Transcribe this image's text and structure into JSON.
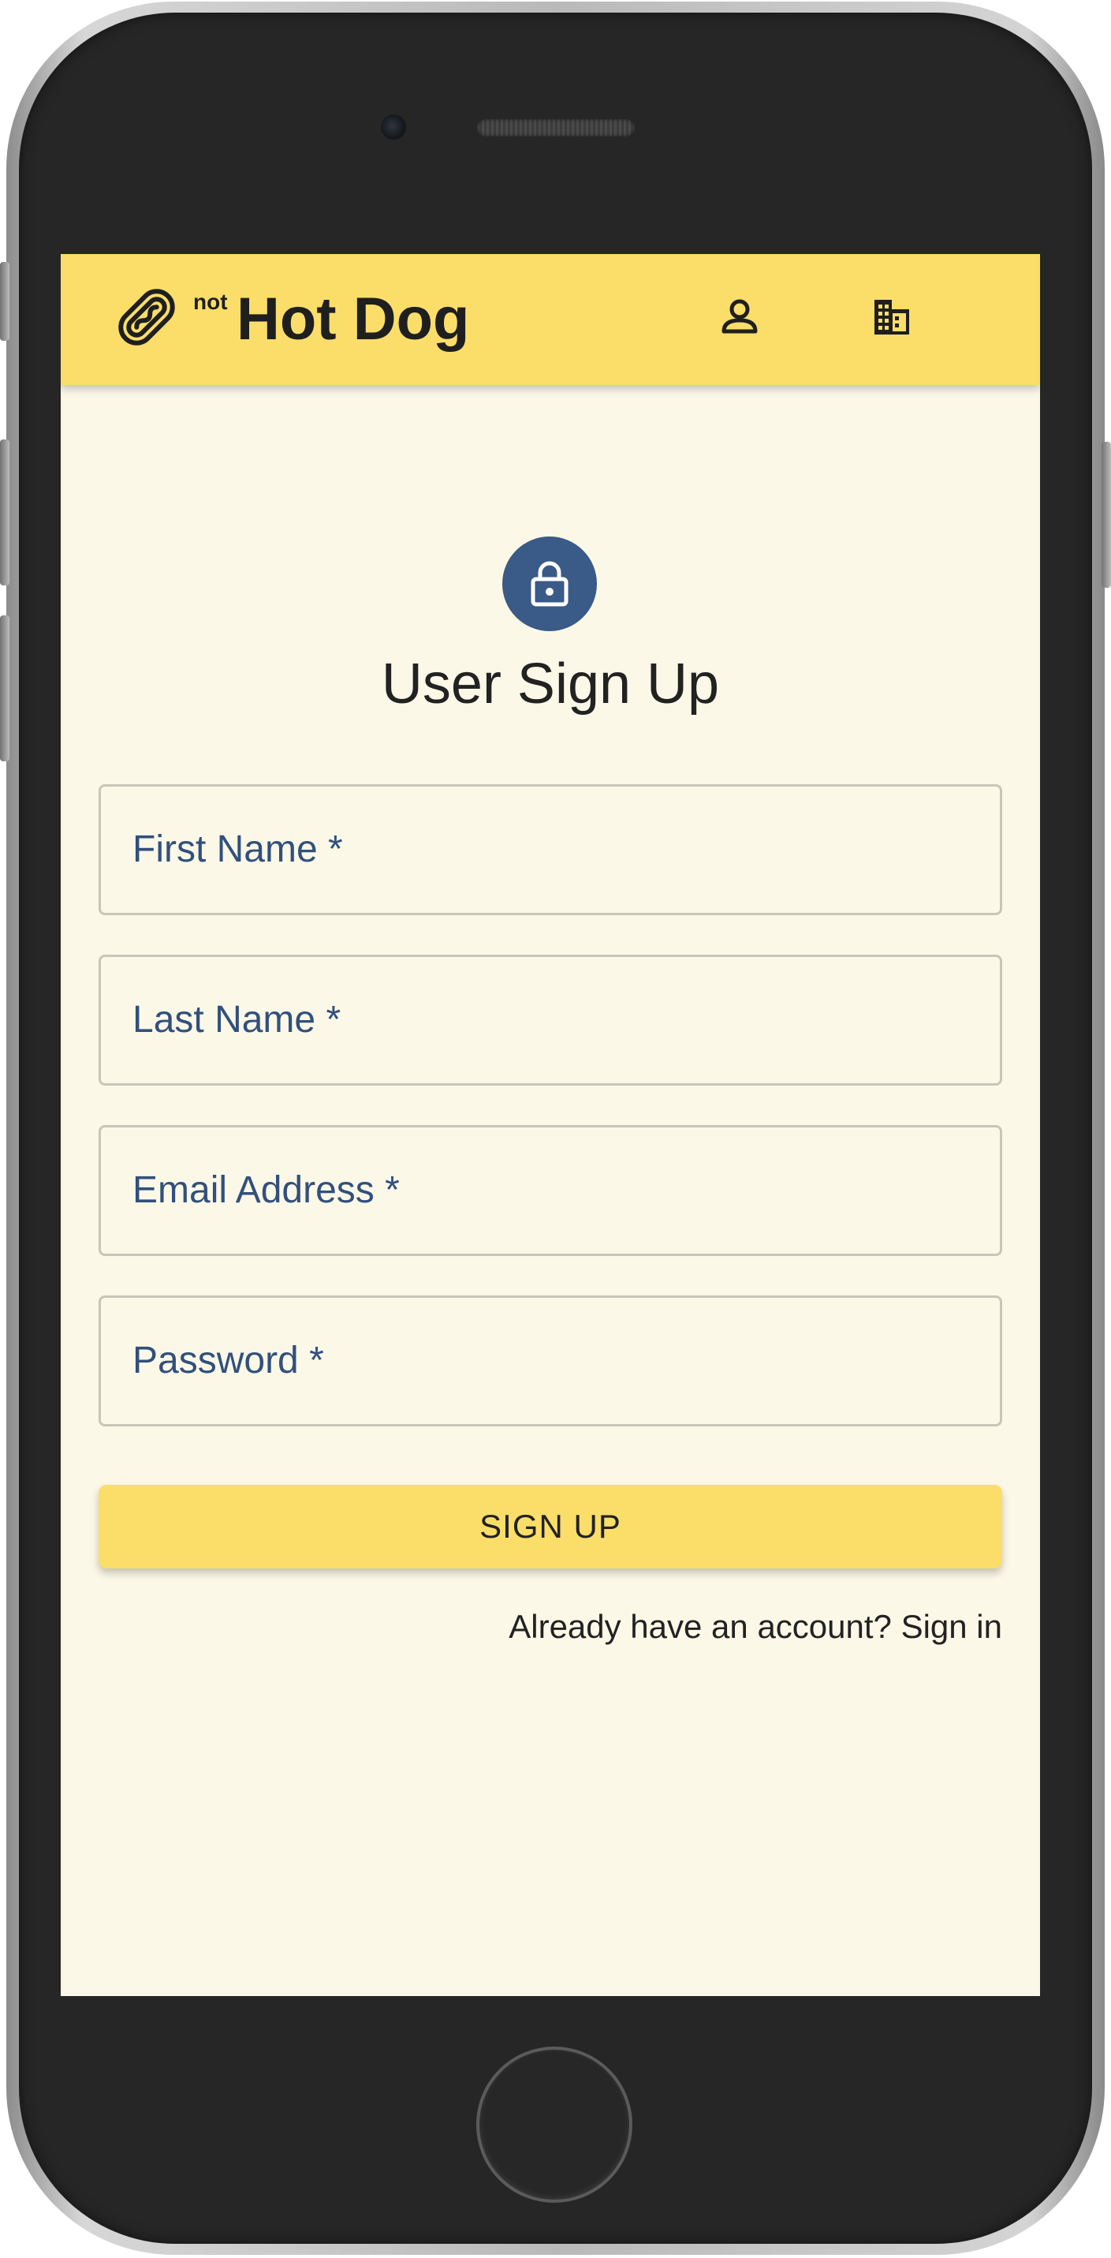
{
  "app_bar": {
    "brand_prefix": "not",
    "brand_name": "Hot Dog",
    "icons": [
      "hot-dog-icon",
      "person-icon",
      "business-icon"
    ]
  },
  "signup_form": {
    "title": "User Sign Up",
    "avatar_icon": "lock-icon",
    "fields": [
      {
        "label": "First Name *",
        "value": ""
      },
      {
        "label": "Last Name *",
        "value": ""
      },
      {
        "label": "Email Address *",
        "value": ""
      },
      {
        "label": "Password *",
        "value": ""
      }
    ],
    "submit_label": "SIGN UP",
    "signin_link": "Already have an account? Sign in"
  },
  "colors": {
    "accent": "#fade69",
    "background": "#fcf8e8",
    "avatar": "#3a5a87",
    "label": "#31507c"
  }
}
